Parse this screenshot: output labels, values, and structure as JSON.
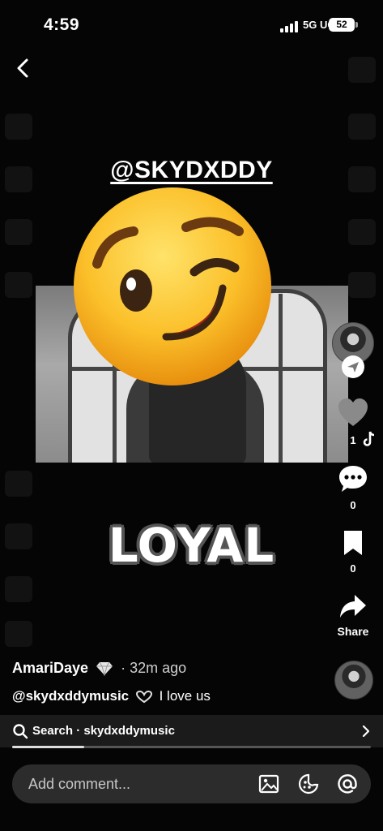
{
  "status_bar": {
    "time": "4:59",
    "network": "5G UC",
    "battery": "52"
  },
  "post": {
    "overlay_handle": "@SKYDXDDY",
    "overlay_word": "LOYAL"
  },
  "actions": {
    "likes": "1",
    "comments": "0",
    "saves": "0",
    "share_label": "Share"
  },
  "caption": {
    "author": "AmariDaye",
    "time_ago": "· 32m ago",
    "mention": "@skydxddymusic",
    "text": "I love us"
  },
  "search_bar": {
    "label": "Search · skydxddymusic",
    "progress": 0.2
  },
  "comment_box": {
    "placeholder": "Add comment..."
  },
  "icons": [
    "back-arrow-icon",
    "send-icon",
    "heart-icon",
    "comment-icon",
    "bookmark-icon",
    "share-icon",
    "search-icon",
    "chevron-right-icon",
    "image-icon",
    "emoji-icon",
    "at-icon",
    "diamond-icon",
    "heart-hands-icon",
    "wink-emoji"
  ],
  "colors": {
    "background": "#000000",
    "bar": "#1b1b1b",
    "input": "#2c2c2c",
    "icon_gray": "#8a8a8a"
  }
}
